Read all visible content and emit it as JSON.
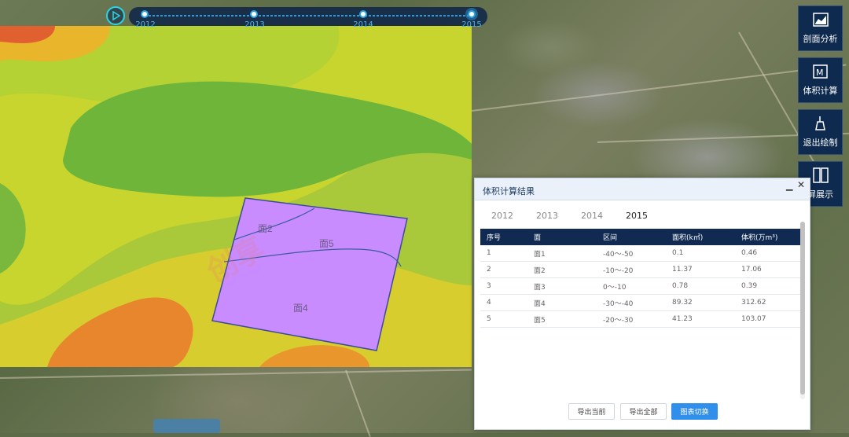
{
  "timeline": {
    "years": [
      "2012",
      "2013",
      "2014",
      "2015"
    ],
    "active_index": 3
  },
  "map": {
    "polygon_labels": [
      "面2",
      "面5",
      "面4"
    ],
    "watermark": "智博"
  },
  "toolbar": {
    "items": [
      {
        "label": "剖面分析",
        "icon": "chart-icon"
      },
      {
        "label": "体积计算",
        "icon": "volume-icon"
      },
      {
        "label": "退出绘制",
        "icon": "broom-icon"
      },
      {
        "label": "屏展示",
        "icon": "split-screen-icon"
      }
    ]
  },
  "dialog": {
    "title": "体积计算结果",
    "tabs": [
      "2012",
      "2013",
      "2014",
      "2015"
    ],
    "active_tab": "2015",
    "columns": [
      "序号",
      "面",
      "区间",
      "面积(k㎡)",
      "体积(万m³)"
    ],
    "rows": [
      [
        "1",
        "面1",
        "-40～-50",
        "0.1",
        "0.46"
      ],
      [
        "2",
        "面2",
        "-10～-20",
        "11.37",
        "17.06"
      ],
      [
        "3",
        "面3",
        "0～-10",
        "0.78",
        "0.39"
      ],
      [
        "4",
        "面4",
        "-30～-40",
        "89.32",
        "312.62"
      ],
      [
        "5",
        "面5",
        "-20～-30",
        "41.23",
        "103.07"
      ]
    ],
    "buttons": {
      "export_current": "导出当前",
      "export_all": "导出全部",
      "toggle_chart": "图表切换"
    }
  },
  "colors": {
    "toolbar_bg": "#0e2a4f",
    "table_header_bg": "#102a52",
    "primary_button": "#2f8fea",
    "polygon_fill": "#c88cff",
    "timeline_accent": "#2aa2e6"
  }
}
